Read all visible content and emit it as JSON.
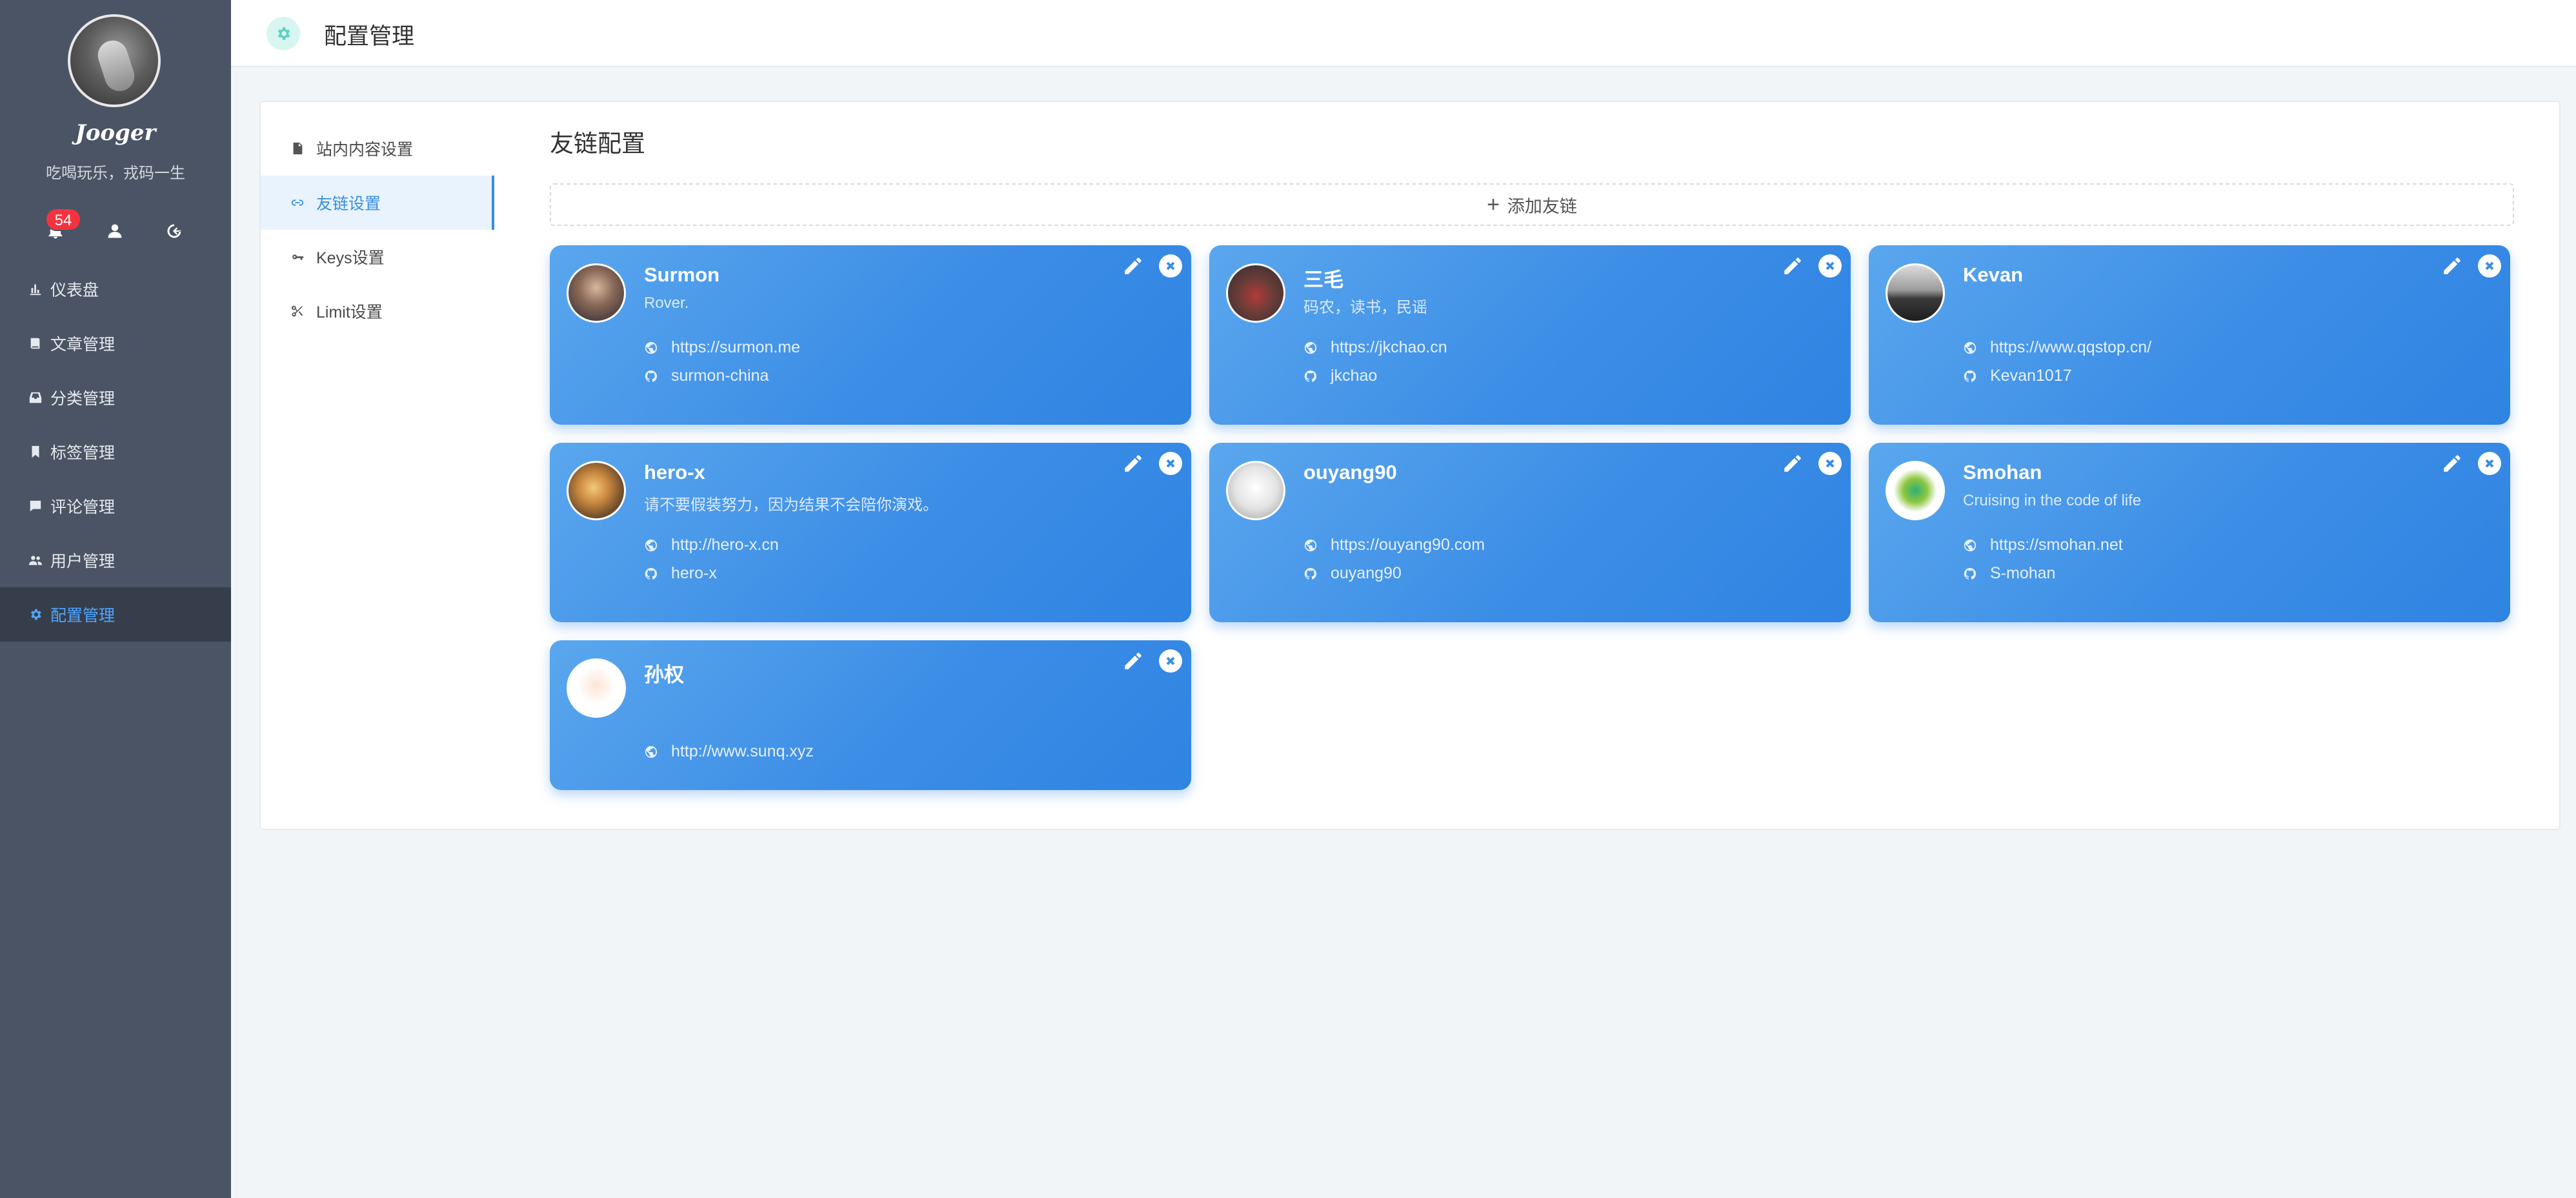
{
  "sidebar": {
    "site_name": "Jooger",
    "slogan": "吃喝玩乐，戎码一生",
    "notification_count": "54",
    "nav": [
      {
        "label": "仪表盘",
        "icon": "chart-icon"
      },
      {
        "label": "文章管理",
        "icon": "book-icon"
      },
      {
        "label": "分类管理",
        "icon": "inbox-icon"
      },
      {
        "label": "标签管理",
        "icon": "bookmark-icon"
      },
      {
        "label": "评论管理",
        "icon": "comment-icon"
      },
      {
        "label": "用户管理",
        "icon": "team-icon"
      },
      {
        "label": "配置管理",
        "icon": "gear-icon",
        "active": true
      }
    ]
  },
  "header": {
    "title": "配置管理"
  },
  "subnav": [
    {
      "label": "站内内容设置",
      "icon": "file-icon"
    },
    {
      "label": "友链设置",
      "icon": "link-icon",
      "active": true
    },
    {
      "label": "Keys设置",
      "icon": "key-icon"
    },
    {
      "label": "Limit设置",
      "icon": "scissor-icon"
    }
  ],
  "content": {
    "title": "友链配置",
    "add_label": "添加友链",
    "links": [
      {
        "name": "Surmon",
        "desc": "Rover.",
        "site": "https://surmon.me",
        "github": "surmon-china"
      },
      {
        "name": "三毛",
        "desc": "码农，读书，民谣",
        "site": "https://jkchao.cn",
        "github": "jkchao"
      },
      {
        "name": "Kevan",
        "desc": "",
        "site": "https://www.qqstop.cn/",
        "github": "Kevan1017"
      },
      {
        "name": "hero-x",
        "desc": "请不要假装努力，因为结果不会陪你演戏。",
        "site": "http://hero-x.cn",
        "github": "hero-x"
      },
      {
        "name": "ouyang90",
        "desc": "",
        "site": "https://ouyang90.com",
        "github": "ouyang90"
      },
      {
        "name": "Smohan",
        "desc": "Cruising in the code of life",
        "site": "https://smohan.net",
        "github": "S-mohan"
      },
      {
        "name": "孙权",
        "desc": "",
        "site": "http://www.sunq.xyz",
        "github": ""
      }
    ]
  },
  "colors": {
    "sidebar_bg": "#4a5465",
    "accent": "#3a8de2",
    "card_gradient_start": "#5aa7ee",
    "card_gradient_end": "#2f84e2",
    "badge": "#f5333f"
  }
}
